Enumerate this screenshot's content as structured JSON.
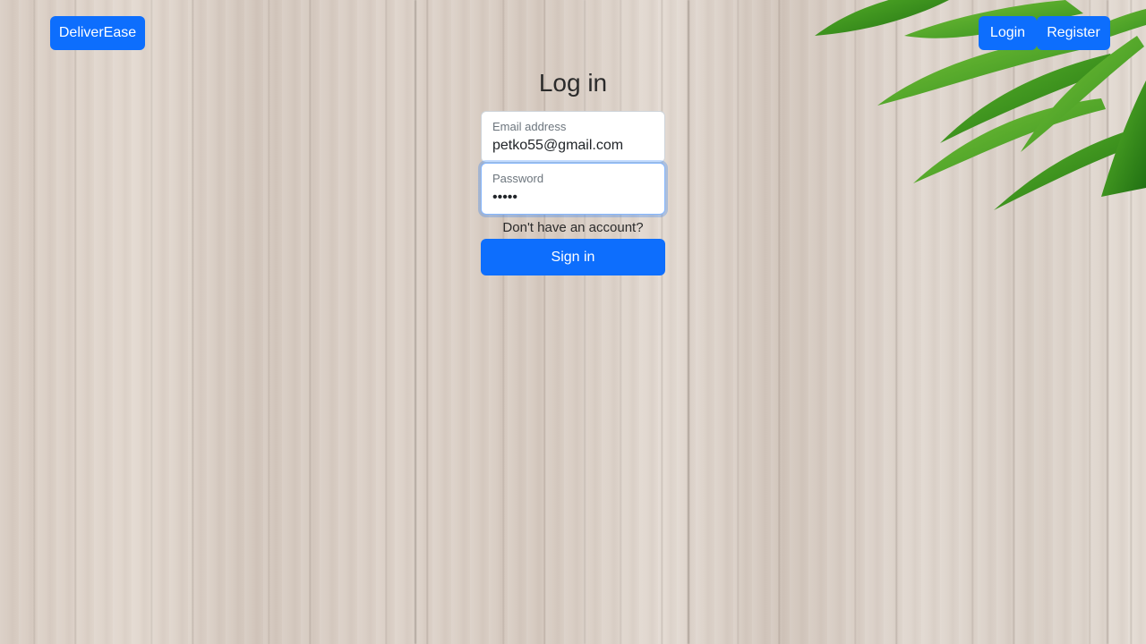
{
  "header": {
    "brand_label": "DeliverEase",
    "login_label": "Login",
    "register_label": "Register"
  },
  "login_form": {
    "title": "Log in",
    "email": {
      "label": "Email address",
      "value": "petko55@gmail.com"
    },
    "password": {
      "label": "Password",
      "value": "•••••"
    },
    "signup_prompt": "Don't have an account?",
    "submit_label": "Sign in"
  },
  "colors": {
    "primary": "#0d6efd",
    "focus_ring": "#86b7fe"
  },
  "background": {
    "decoration": "leaves-icon"
  }
}
